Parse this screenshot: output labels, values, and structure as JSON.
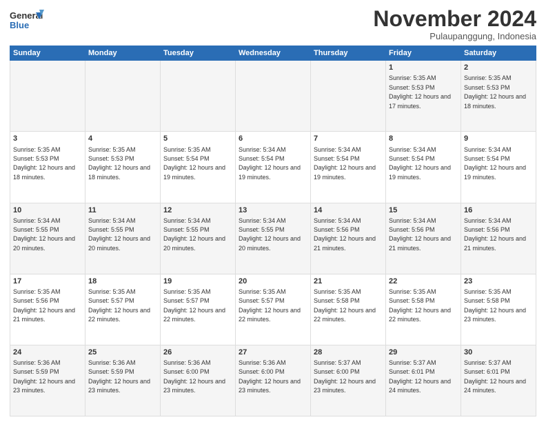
{
  "header": {
    "logo_line1": "General",
    "logo_line2": "Blue",
    "month": "November 2024",
    "location": "Pulaupanggung, Indonesia"
  },
  "weekdays": [
    "Sunday",
    "Monday",
    "Tuesday",
    "Wednesday",
    "Thursday",
    "Friday",
    "Saturday"
  ],
  "weeks": [
    [
      {
        "day": "",
        "sunrise": "",
        "sunset": "",
        "daylight": ""
      },
      {
        "day": "",
        "sunrise": "",
        "sunset": "",
        "daylight": ""
      },
      {
        "day": "",
        "sunrise": "",
        "sunset": "",
        "daylight": ""
      },
      {
        "day": "",
        "sunrise": "",
        "sunset": "",
        "daylight": ""
      },
      {
        "day": "",
        "sunrise": "",
        "sunset": "",
        "daylight": ""
      },
      {
        "day": "1",
        "sunrise": "Sunrise: 5:35 AM",
        "sunset": "Sunset: 5:53 PM",
        "daylight": "Daylight: 12 hours and 17 minutes."
      },
      {
        "day": "2",
        "sunrise": "Sunrise: 5:35 AM",
        "sunset": "Sunset: 5:53 PM",
        "daylight": "Daylight: 12 hours and 18 minutes."
      }
    ],
    [
      {
        "day": "3",
        "sunrise": "Sunrise: 5:35 AM",
        "sunset": "Sunset: 5:53 PM",
        "daylight": "Daylight: 12 hours and 18 minutes."
      },
      {
        "day": "4",
        "sunrise": "Sunrise: 5:35 AM",
        "sunset": "Sunset: 5:53 PM",
        "daylight": "Daylight: 12 hours and 18 minutes."
      },
      {
        "day": "5",
        "sunrise": "Sunrise: 5:35 AM",
        "sunset": "Sunset: 5:54 PM",
        "daylight": "Daylight: 12 hours and 19 minutes."
      },
      {
        "day": "6",
        "sunrise": "Sunrise: 5:34 AM",
        "sunset": "Sunset: 5:54 PM",
        "daylight": "Daylight: 12 hours and 19 minutes."
      },
      {
        "day": "7",
        "sunrise": "Sunrise: 5:34 AM",
        "sunset": "Sunset: 5:54 PM",
        "daylight": "Daylight: 12 hours and 19 minutes."
      },
      {
        "day": "8",
        "sunrise": "Sunrise: 5:34 AM",
        "sunset": "Sunset: 5:54 PM",
        "daylight": "Daylight: 12 hours and 19 minutes."
      },
      {
        "day": "9",
        "sunrise": "Sunrise: 5:34 AM",
        "sunset": "Sunset: 5:54 PM",
        "daylight": "Daylight: 12 hours and 19 minutes."
      }
    ],
    [
      {
        "day": "10",
        "sunrise": "Sunrise: 5:34 AM",
        "sunset": "Sunset: 5:55 PM",
        "daylight": "Daylight: 12 hours and 20 minutes."
      },
      {
        "day": "11",
        "sunrise": "Sunrise: 5:34 AM",
        "sunset": "Sunset: 5:55 PM",
        "daylight": "Daylight: 12 hours and 20 minutes."
      },
      {
        "day": "12",
        "sunrise": "Sunrise: 5:34 AM",
        "sunset": "Sunset: 5:55 PM",
        "daylight": "Daylight: 12 hours and 20 minutes."
      },
      {
        "day": "13",
        "sunrise": "Sunrise: 5:34 AM",
        "sunset": "Sunset: 5:55 PM",
        "daylight": "Daylight: 12 hours and 20 minutes."
      },
      {
        "day": "14",
        "sunrise": "Sunrise: 5:34 AM",
        "sunset": "Sunset: 5:56 PM",
        "daylight": "Daylight: 12 hours and 21 minutes."
      },
      {
        "day": "15",
        "sunrise": "Sunrise: 5:34 AM",
        "sunset": "Sunset: 5:56 PM",
        "daylight": "Daylight: 12 hours and 21 minutes."
      },
      {
        "day": "16",
        "sunrise": "Sunrise: 5:34 AM",
        "sunset": "Sunset: 5:56 PM",
        "daylight": "Daylight: 12 hours and 21 minutes."
      }
    ],
    [
      {
        "day": "17",
        "sunrise": "Sunrise: 5:35 AM",
        "sunset": "Sunset: 5:56 PM",
        "daylight": "Daylight: 12 hours and 21 minutes."
      },
      {
        "day": "18",
        "sunrise": "Sunrise: 5:35 AM",
        "sunset": "Sunset: 5:57 PM",
        "daylight": "Daylight: 12 hours and 22 minutes."
      },
      {
        "day": "19",
        "sunrise": "Sunrise: 5:35 AM",
        "sunset": "Sunset: 5:57 PM",
        "daylight": "Daylight: 12 hours and 22 minutes."
      },
      {
        "day": "20",
        "sunrise": "Sunrise: 5:35 AM",
        "sunset": "Sunset: 5:57 PM",
        "daylight": "Daylight: 12 hours and 22 minutes."
      },
      {
        "day": "21",
        "sunrise": "Sunrise: 5:35 AM",
        "sunset": "Sunset: 5:58 PM",
        "daylight": "Daylight: 12 hours and 22 minutes."
      },
      {
        "day": "22",
        "sunrise": "Sunrise: 5:35 AM",
        "sunset": "Sunset: 5:58 PM",
        "daylight": "Daylight: 12 hours and 22 minutes."
      },
      {
        "day": "23",
        "sunrise": "Sunrise: 5:35 AM",
        "sunset": "Sunset: 5:58 PM",
        "daylight": "Daylight: 12 hours and 23 minutes."
      }
    ],
    [
      {
        "day": "24",
        "sunrise": "Sunrise: 5:36 AM",
        "sunset": "Sunset: 5:59 PM",
        "daylight": "Daylight: 12 hours and 23 minutes."
      },
      {
        "day": "25",
        "sunrise": "Sunrise: 5:36 AM",
        "sunset": "Sunset: 5:59 PM",
        "daylight": "Daylight: 12 hours and 23 minutes."
      },
      {
        "day": "26",
        "sunrise": "Sunrise: 5:36 AM",
        "sunset": "Sunset: 6:00 PM",
        "daylight": "Daylight: 12 hours and 23 minutes."
      },
      {
        "day": "27",
        "sunrise": "Sunrise: 5:36 AM",
        "sunset": "Sunset: 6:00 PM",
        "daylight": "Daylight: 12 hours and 23 minutes."
      },
      {
        "day": "28",
        "sunrise": "Sunrise: 5:37 AM",
        "sunset": "Sunset: 6:00 PM",
        "daylight": "Daylight: 12 hours and 23 minutes."
      },
      {
        "day": "29",
        "sunrise": "Sunrise: 5:37 AM",
        "sunset": "Sunset: 6:01 PM",
        "daylight": "Daylight: 12 hours and 24 minutes."
      },
      {
        "day": "30",
        "sunrise": "Sunrise: 5:37 AM",
        "sunset": "Sunset: 6:01 PM",
        "daylight": "Daylight: 12 hours and 24 minutes."
      }
    ]
  ]
}
